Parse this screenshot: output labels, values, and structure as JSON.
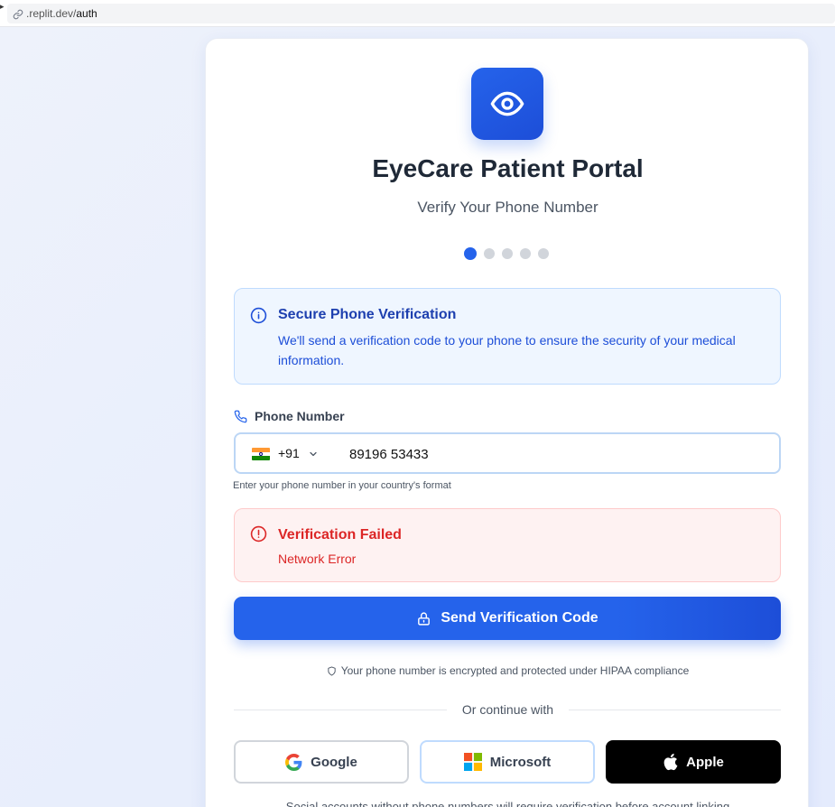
{
  "browser": {
    "url_prefix": ".replit.dev/",
    "url_path": "auth"
  },
  "header": {
    "title": "EyeCare Patient Portal",
    "subtitle": "Verify Your Phone Number",
    "steps_total": 5,
    "active_step": 1
  },
  "info_box": {
    "title": "Secure Phone Verification",
    "text": "We'll send a verification code to your phone to ensure the security of your medical information."
  },
  "phone": {
    "label": "Phone Number",
    "country_code": "+91",
    "country_flag": "india-flag",
    "value": "89196 53433",
    "hint": "Enter your phone number in your country's format"
  },
  "error": {
    "title": "Verification Failed",
    "message": "Network Error"
  },
  "send_button": {
    "label": "Send Verification Code"
  },
  "hipaa_note": "Your phone number is encrypted and protected under HIPAA compliance",
  "divider_text": "Or continue with",
  "social": {
    "google": "Google",
    "microsoft": "Microsoft",
    "apple": "Apple"
  },
  "footnote": "Social accounts without phone numbers will require verification before account linking",
  "colors": {
    "primary": "#2563eb",
    "error": "#dc2626",
    "info_bg": "#eff6ff"
  }
}
